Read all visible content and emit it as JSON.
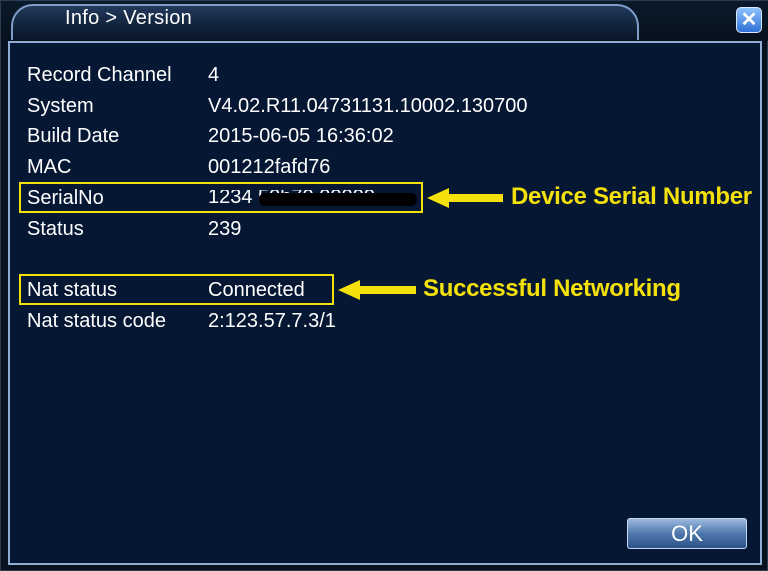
{
  "window": {
    "title": "Info > Version",
    "close_label": "✕"
  },
  "info": {
    "rows": [
      {
        "label": "Record Channel",
        "value": "4"
      },
      {
        "label": "System",
        "value": "V4.02.R11.04731131.10002.130700"
      },
      {
        "label": "Build Date",
        "value": "2015-06-05 16:36:02"
      },
      {
        "label": "MAC",
        "value": "001212fafd76"
      },
      {
        "label": "SerialNo",
        "value": "1234 50b70 00000"
      },
      {
        "label": "Status",
        "value": "239"
      },
      {
        "label": "Nat status",
        "value": "Connected"
      },
      {
        "label": "Nat status code",
        "value": "2:123.57.7.3/1"
      }
    ]
  },
  "annotations": {
    "serial": "Device Serial Number",
    "nat": "Successful Networking",
    "color": "#f4e10c"
  },
  "buttons": {
    "ok": "OK"
  }
}
